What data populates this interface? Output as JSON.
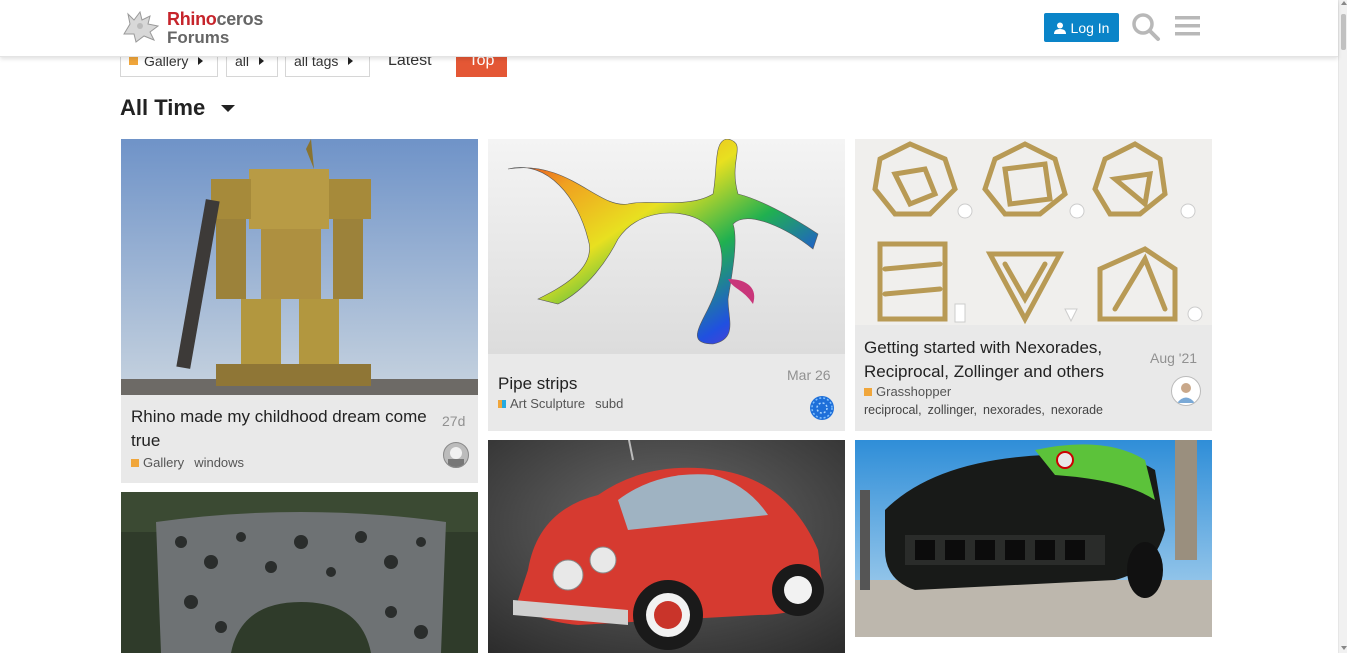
{
  "brand": {
    "logo_red": "Rhino",
    "logo_rest": "ceros",
    "logo_line2": "Forums"
  },
  "header": {
    "login_label": "Log In"
  },
  "nav": {
    "category": "Gallery",
    "subcategory": "all",
    "tags": "all tags",
    "latest": "Latest",
    "top": "Top"
  },
  "period": "All Time",
  "colors": {
    "accent": "#e45735",
    "login": "#0a84c8",
    "gallery_cat": "#f0a63b",
    "grasshopper_cat": "#f0a63b"
  },
  "topics": [
    {
      "title": "Rhino made my childhood dream come true",
      "date": "27d",
      "category": "Gallery",
      "tags": [
        "windows"
      ]
    },
    {
      "title": "Pipe strips",
      "date": "Mar 26",
      "category": "Art Sculpture",
      "tags": [
        "subd"
      ]
    },
    {
      "title": "Getting started with Nexorades, Reciprocal, Zollinger and others",
      "date": "Aug '21",
      "category": "Grasshopper",
      "tags": [
        "reciprocal,",
        "zollinger,",
        "nexorades,",
        "nexorade"
      ]
    }
  ]
}
